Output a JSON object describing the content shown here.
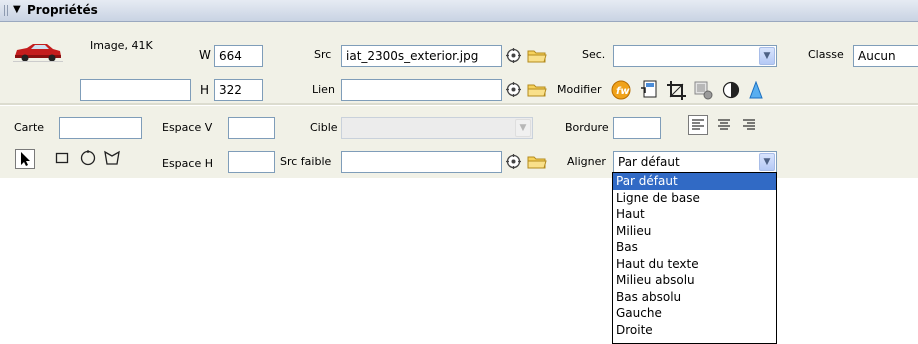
{
  "title": "Propriétés",
  "image": {
    "info": "Image, 41K",
    "name_value": ""
  },
  "size": {
    "w_label": "W",
    "w_value": "664",
    "h_label": "H",
    "h_value": "322"
  },
  "src": {
    "label": "Src",
    "value": "iat_2300s_exterior.jpg"
  },
  "link": {
    "label": "Lien",
    "value": ""
  },
  "sec": {
    "label": "Sec.",
    "value": ""
  },
  "classe": {
    "label": "Classe",
    "value": "Aucun"
  },
  "modifier": {
    "label": "Modifier"
  },
  "map": {
    "label": "Carte",
    "value": ""
  },
  "vspace": {
    "label": "Espace V",
    "value": ""
  },
  "hspace": {
    "label": "Espace H",
    "value": ""
  },
  "target": {
    "label": "Cible",
    "value": ""
  },
  "border": {
    "label": "Bordure",
    "value": ""
  },
  "lowsrc": {
    "label": "Src faible",
    "value": ""
  },
  "align": {
    "label": "Aligner",
    "value": "Par défaut",
    "options": [
      "Par défaut",
      "Ligne de base",
      "Haut",
      "Milieu",
      "Bas",
      "Haut du texte",
      "Milieu absolu",
      "Bas absolu",
      "Gauche",
      "Droite"
    ],
    "selected_index": 0
  },
  "colors": {
    "accent": "#316ac5",
    "panel": "#f1f1e7",
    "titlebar": "#c9d3e3"
  }
}
